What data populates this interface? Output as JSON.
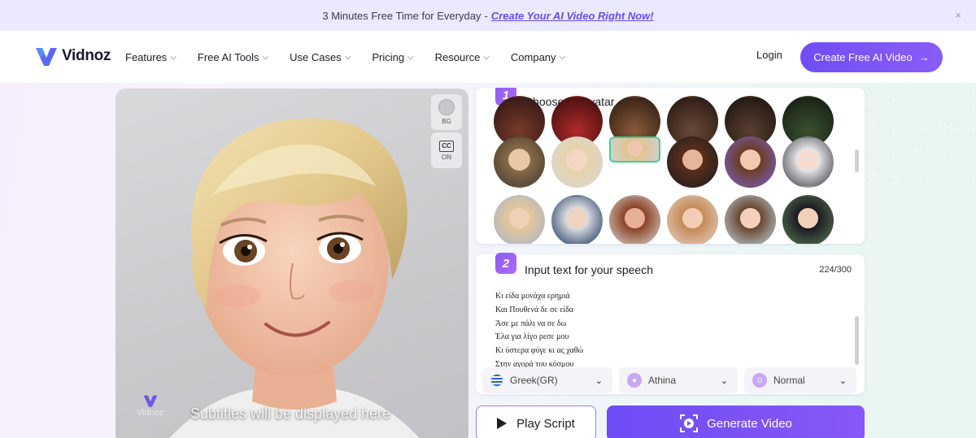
{
  "banner": {
    "text": "3 Minutes Free Time for Everyday",
    "separator": "-",
    "cta": "Create Your AI Video Right Now!",
    "close": "×"
  },
  "nav": {
    "logo": "Vidnoz",
    "menu": [
      {
        "label": "Features"
      },
      {
        "label": "Free AI Tools"
      },
      {
        "label": "Use Cases"
      },
      {
        "label": "Pricing"
      },
      {
        "label": "Resource"
      },
      {
        "label": "Company"
      }
    ],
    "chevron": "⌵",
    "login": "Login",
    "create": "Create Free AI Video",
    "create_arrow": "→"
  },
  "preview": {
    "bg_label": "BG",
    "cc_label": "CC",
    "cc_state": "ON",
    "subtitle": "Subtitles will be displayed here",
    "watermark": "Vidnoz"
  },
  "step1": {
    "number": "1",
    "title": "Choose an avatar"
  },
  "step2": {
    "number": "2",
    "title": "Input text for your speech",
    "count": "224/300",
    "lines": [
      "Κι είδα μονάχα ερημιά",
      "Και Πουθενά δε σε είδα",
      "Άσε με πάλι να σε δω",
      "Έλα για λίγο ρεσε μου",
      "Κι ύστερα φύγε κι ας χαθώ",
      "Στην αγορά του κόσμου"
    ],
    "language": "Greek(GR)",
    "voice": "Athina",
    "style": "Normal"
  },
  "actions": {
    "play": "Play Script",
    "generate": "Generate Video"
  },
  "colors": {
    "accent": "#6f4ef6",
    "selected_ring": "#3fd091",
    "banner_bg": "#ebe9ff"
  }
}
